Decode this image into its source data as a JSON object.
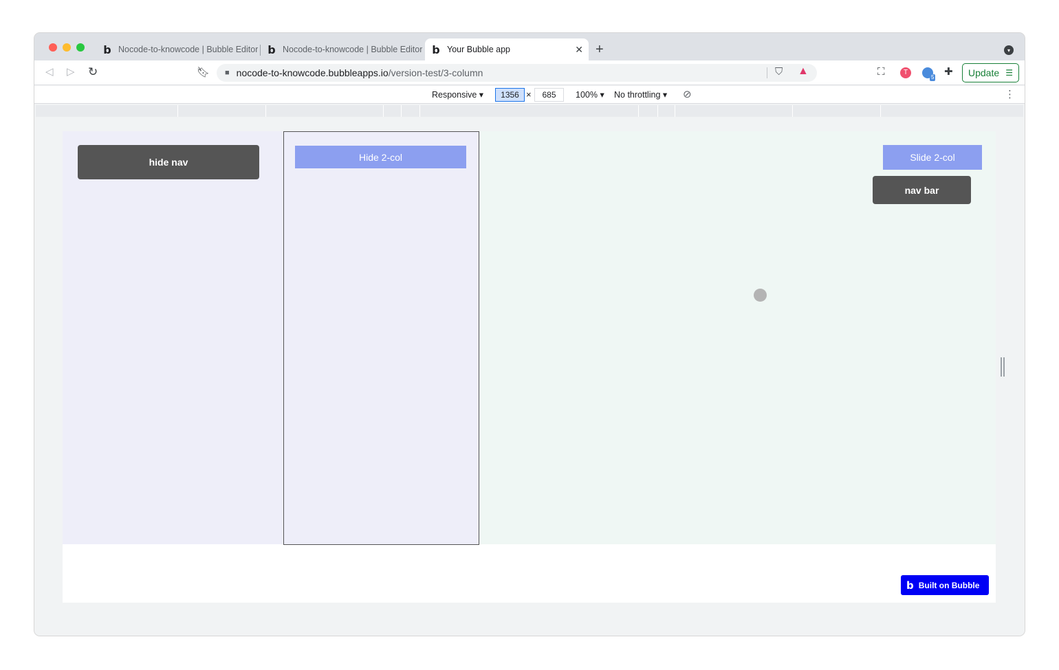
{
  "browser": {
    "tabs": [
      {
        "title": "Nocode-to-knowcode | Bubble Editor",
        "favicon": "bubble-logo"
      },
      {
        "title": "Nocode-to-knowcode | Bubble Editor",
        "favicon": "bubble-logo"
      },
      {
        "title": "Your Bubble app",
        "favicon": "bubble-logo",
        "active": true
      }
    ],
    "url_host": "nocode-to-knowcode.bubbleapps.io",
    "url_path": "/version-test/3-column",
    "update_label": "Update"
  },
  "devtools": {
    "device": "Responsive ▾",
    "width": "1356",
    "height": "685",
    "x": "×",
    "zoom": "100% ▾",
    "throttling": "No throttling ▾"
  },
  "app": {
    "hide_nav_label": "hide nav",
    "hide_2col_label": "Hide 2-col",
    "slide_2col_label": "Slide 2-col",
    "nav_bar_label": "nav bar",
    "built_on_bubble_label": "Built on Bubble"
  },
  "colors": {
    "accent_button": "#8c9ff0",
    "dark_button": "#555555",
    "col_bg_purple": "#eeeef9",
    "col_bg_green": "#eff7f4",
    "bubble_badge": "#0000f5",
    "update_green": "#188038"
  }
}
